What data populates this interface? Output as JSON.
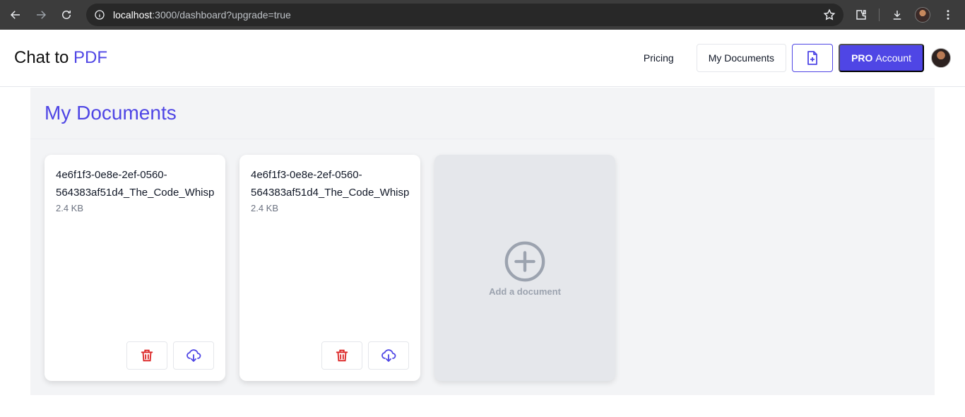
{
  "browser": {
    "url_host": "localhost",
    "url_rest": ":3000/dashboard?upgrade=true",
    "icons": [
      "back-icon",
      "forward-icon",
      "reload-icon",
      "info-icon",
      "star-icon",
      "extensions-icon",
      "download-icon",
      "profile-avatar",
      "menu-icon"
    ]
  },
  "header": {
    "brand_prefix": "Chat to ",
    "brand_accent": "PDF",
    "pricing": "Pricing",
    "my_documents": "My Documents",
    "pro_bold": "PRO",
    "pro_rest": "Account"
  },
  "main": {
    "title": "My Documents",
    "documents": [
      {
        "name_line1": "4e6f1f3-0e8e-2ef-0560-",
        "name_line2": "564383af51d4_The_Code_Whisp",
        "size": "2.4 KB"
      },
      {
        "name_line1": "4e6f1f3-0e8e-2ef-0560-",
        "name_line2": "564383af51d4_The_Code_Whisp",
        "size": "2.4 KB"
      }
    ],
    "add_label": "Add a document"
  },
  "colors": {
    "accent": "#4f46e5",
    "delete": "#dc2626",
    "panel": "#f3f4f6"
  }
}
